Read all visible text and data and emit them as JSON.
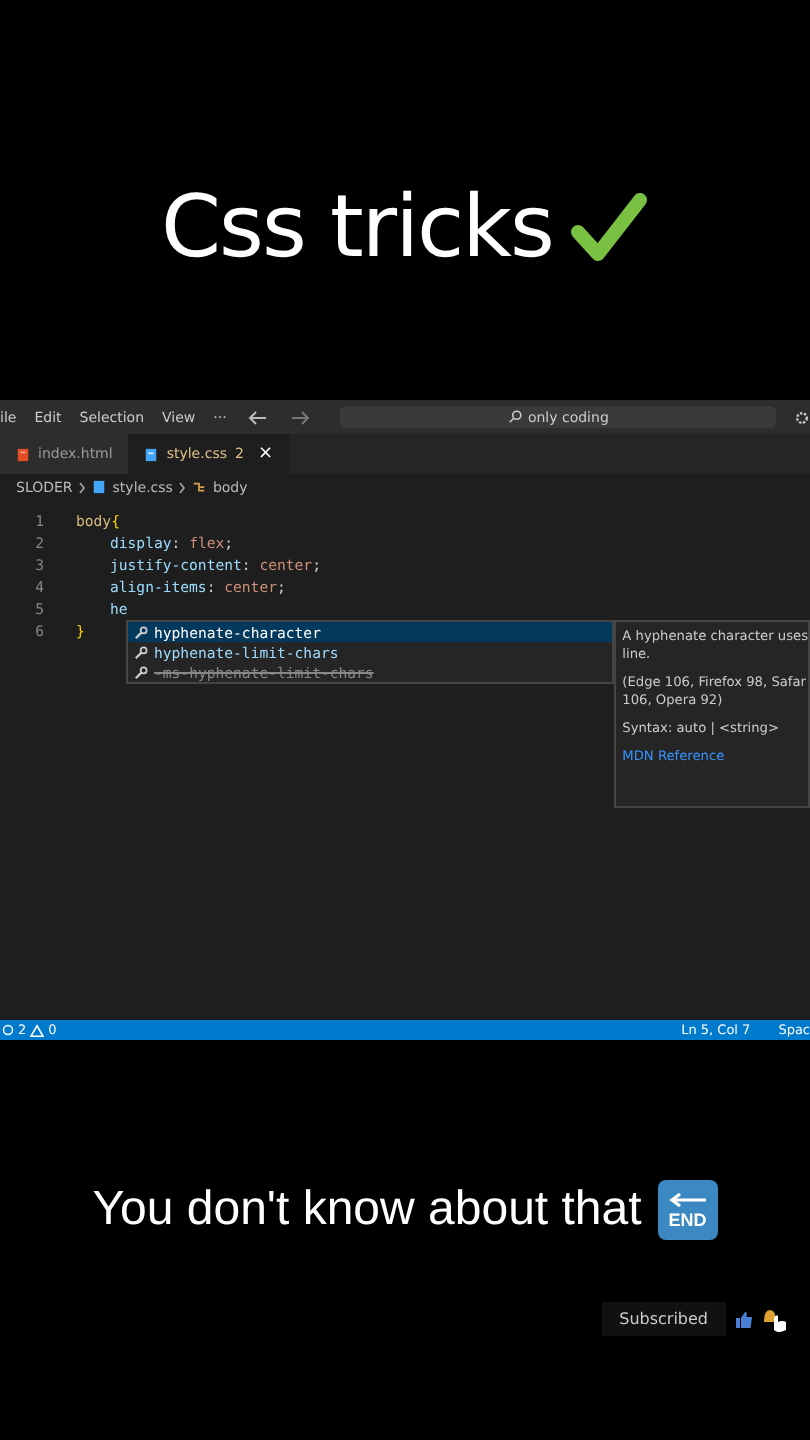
{
  "title": "Css tricks",
  "editor": {
    "menu": [
      "ile",
      "Edit",
      "Selection",
      "View",
      "···"
    ],
    "search": {
      "value": "only coding"
    },
    "tabs": [
      {
        "label": "index.html",
        "kind": "html",
        "selected": false
      },
      {
        "label": "style.css",
        "kind": "css",
        "selected": true,
        "badge": "2",
        "close": "×"
      }
    ],
    "breadcrumb": [
      "SLODER",
      "style.css",
      "body"
    ],
    "lines": [
      {
        "number": "1",
        "indented": false,
        "tokens": [
          {
            "kind": "selector",
            "text": "body"
          },
          {
            "kind": "brace",
            "text": "{"
          }
        ]
      },
      {
        "number": "2",
        "indented": true,
        "tokens": [
          {
            "kind": "property",
            "text": "display"
          },
          {
            "kind": "punct",
            "text": ": "
          },
          {
            "kind": "value",
            "text": "flex"
          },
          {
            "kind": "punct",
            "text": ";"
          }
        ]
      },
      {
        "number": "3",
        "indented": true,
        "tokens": [
          {
            "kind": "property",
            "text": "justify-content"
          },
          {
            "kind": "punct",
            "text": ": "
          },
          {
            "kind": "value",
            "text": "center"
          },
          {
            "kind": "punct",
            "text": ";"
          }
        ]
      },
      {
        "number": "4",
        "indented": true,
        "tokens": [
          {
            "kind": "property",
            "text": "align-items"
          },
          {
            "kind": "punct",
            "text": ": "
          },
          {
            "kind": "value",
            "text": "center"
          },
          {
            "kind": "punct",
            "text": ";"
          }
        ]
      },
      {
        "number": "5",
        "indented": true,
        "tokens": [
          {
            "kind": "property",
            "text": "he"
          }
        ]
      },
      {
        "number": "6",
        "indented": false,
        "tokens": [
          {
            "kind": "brace",
            "text": "}"
          }
        ]
      }
    ],
    "suggestions": [
      {
        "label": "hyphenate-character",
        "selected": true,
        "deprecated": false
      },
      {
        "label": "hyphenate-limit-chars",
        "selected": false,
        "deprecated": false
      },
      {
        "label": "-ms-hyphenate-limit-chars",
        "selected": false,
        "deprecated": true
      }
    ],
    "docs": {
      "paragraphs": [
        [
          "A hyphenate character uses",
          "line."
        ],
        [
          "(Edge 106, Firefox 98, Safar",
          "106, Opera 92)"
        ],
        [
          "Syntax: auto | <string>"
        ]
      ],
      "link": "MDN Reference"
    },
    "status": {
      "errors": "2",
      "warnings": "0",
      "position": "Ln 5, Col 7",
      "spacing": "Spac"
    }
  },
  "caption": "You don't know about that",
  "end_badge": "END",
  "subscribe": {
    "label": "Subscribed"
  }
}
